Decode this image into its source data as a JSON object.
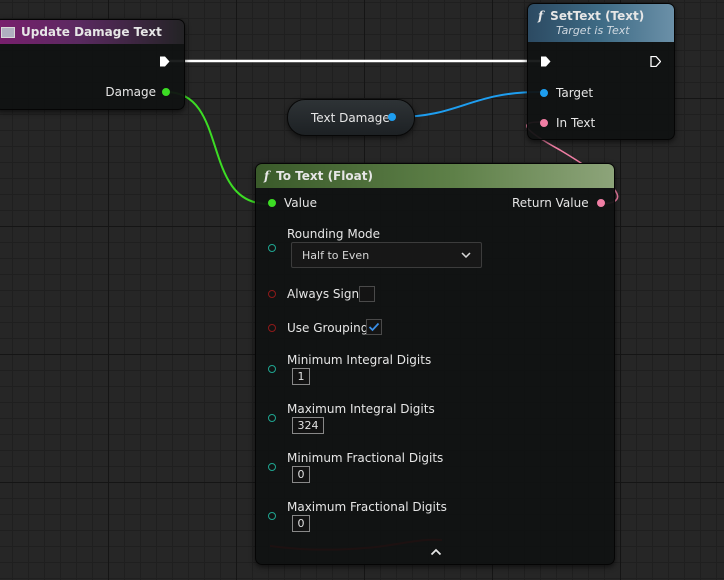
{
  "event_node": {
    "title": "Update Damage Text",
    "pins": {
      "damage": "Damage"
    }
  },
  "settext_node": {
    "title": "SetText (Text)",
    "subtitle": "Target is Text",
    "pins": {
      "target": "Target",
      "in_text": "In Text"
    }
  },
  "variable_node": {
    "label": "Text Damage"
  },
  "totext_node": {
    "title": "To Text (Float)",
    "pins": {
      "value": "Value",
      "return_value": "Return Value",
      "rounding_mode": "Rounding Mode",
      "always_sign": "Always Sign",
      "use_grouping": "Use Grouping",
      "min_integral": "Minimum Integral Digits",
      "max_integral": "Maximum Integral Digits",
      "min_fractional": "Minimum Fractional Digits",
      "max_fractional": "Maximum Fractional Digits"
    },
    "rounding_mode_value": "Half to Even",
    "always_sign_checked": false,
    "use_grouping_checked": true,
    "min_integral_value": "1",
    "max_integral_value": "324",
    "min_fractional_value": "0",
    "max_fractional_value": "0"
  },
  "icons": {
    "function": "function-f-icon",
    "event": "event-icon",
    "dropdown": "chevron-down-icon",
    "collapse": "chevron-up-icon"
  },
  "colors": {
    "exec_wire": "#ffffff",
    "float_wire": "#3cdc24",
    "object_wire": "#1e9ef0",
    "text_wire": "#f07ea4",
    "annotation": "#e00000"
  }
}
